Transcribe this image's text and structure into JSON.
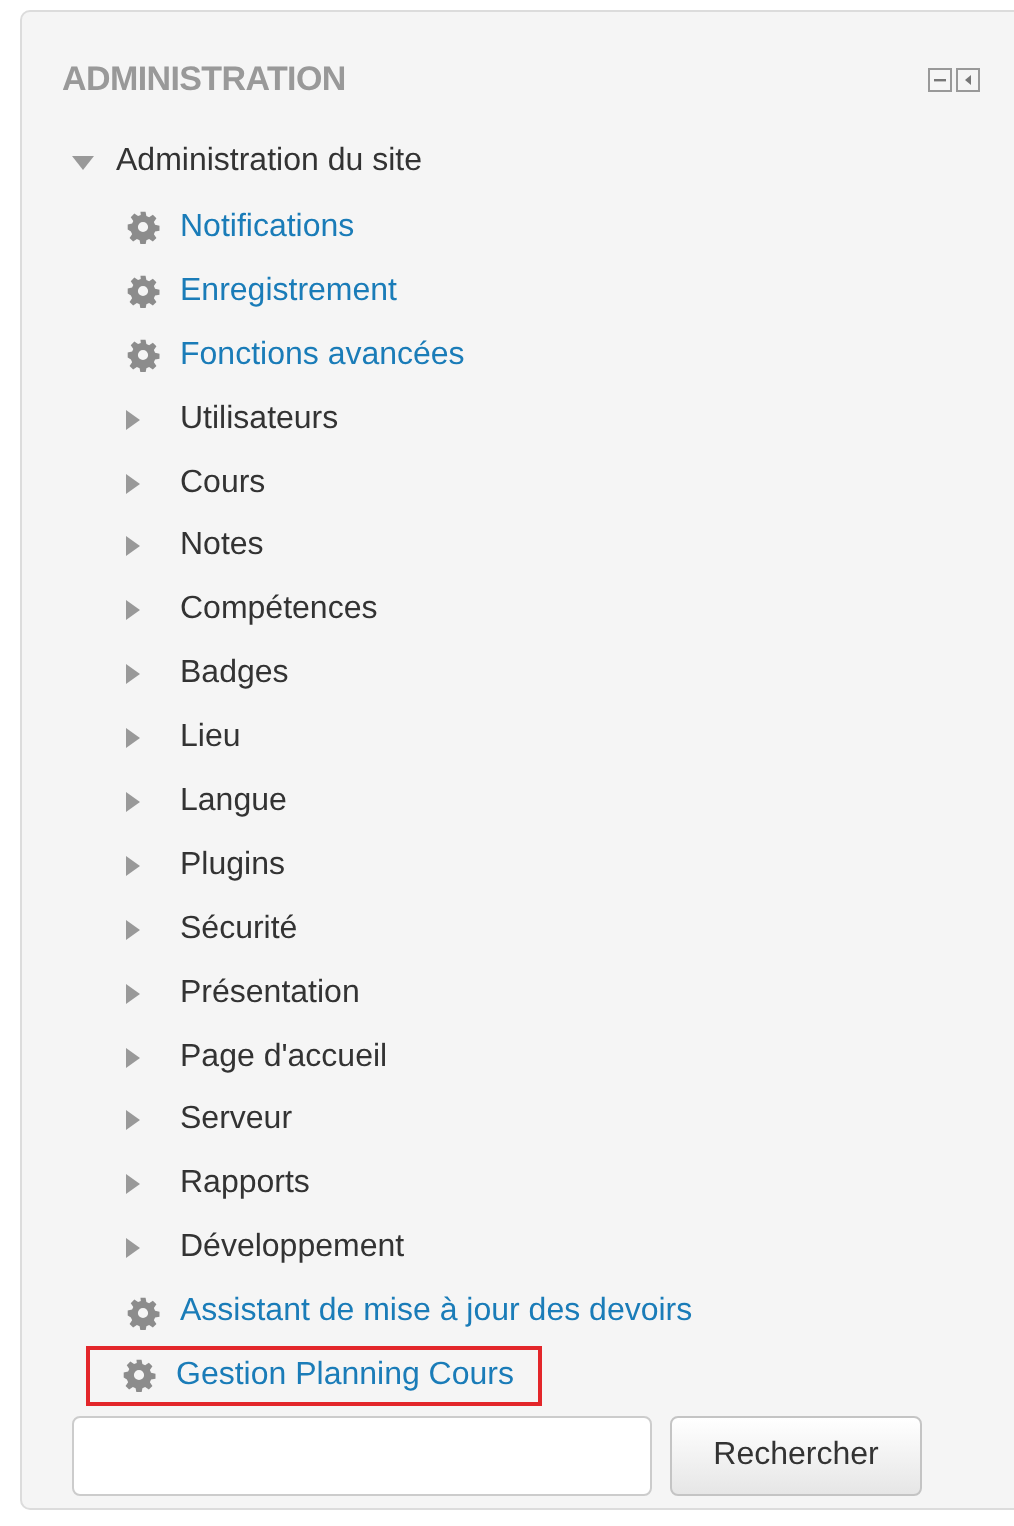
{
  "block": {
    "title": "ADMINISTRATION"
  },
  "tree": {
    "label": "Administration du site",
    "expanded": true,
    "children": [
      {
        "label": "Notifications",
        "kind": "setting",
        "highlighted": false
      },
      {
        "label": "Enregistrement",
        "kind": "setting",
        "highlighted": false
      },
      {
        "label": "Fonctions avancées",
        "kind": "setting",
        "highlighted": false
      },
      {
        "label": "Utilisateurs",
        "kind": "category",
        "expanded": false
      },
      {
        "label": "Cours",
        "kind": "category",
        "expanded": false
      },
      {
        "label": "Notes",
        "kind": "category",
        "expanded": false
      },
      {
        "label": "Compétences",
        "kind": "category",
        "expanded": false
      },
      {
        "label": "Badges",
        "kind": "category",
        "expanded": false
      },
      {
        "label": "Lieu",
        "kind": "category",
        "expanded": false
      },
      {
        "label": "Langue",
        "kind": "category",
        "expanded": false
      },
      {
        "label": "Plugins",
        "kind": "category",
        "expanded": false
      },
      {
        "label": "Sécurité",
        "kind": "category",
        "expanded": false
      },
      {
        "label": "Présentation",
        "kind": "category",
        "expanded": false
      },
      {
        "label": "Page d'accueil",
        "kind": "category",
        "expanded": false
      },
      {
        "label": "Serveur",
        "kind": "category",
        "expanded": false
      },
      {
        "label": "Rapports",
        "kind": "category",
        "expanded": false
      },
      {
        "label": "Développement",
        "kind": "category",
        "expanded": false
      },
      {
        "label": "Assistant de mise à jour des devoirs",
        "kind": "setting",
        "highlighted": false
      },
      {
        "label": "Gestion Planning Cours",
        "kind": "setting",
        "highlighted": true
      }
    ]
  },
  "search": {
    "button": "Rechercher"
  }
}
